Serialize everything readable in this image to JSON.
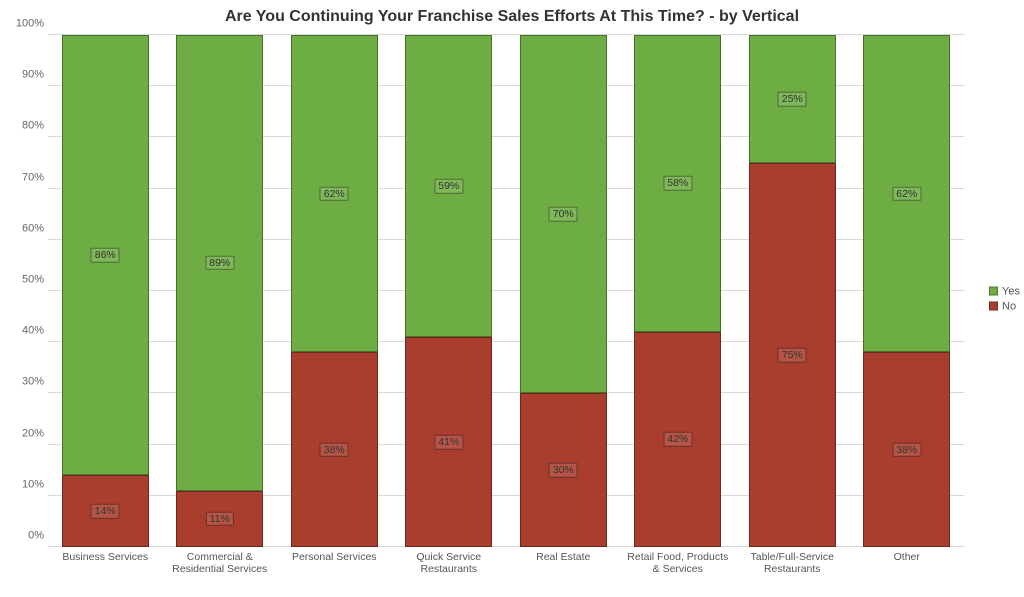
{
  "chart_data": {
    "type": "bar",
    "stacked": true,
    "title": "Are You Continuing Your Franchise Sales Efforts At This Time? - by Vertical",
    "ylabel": "",
    "xlabel": "",
    "ylim": [
      0,
      100
    ],
    "y_ticks": [
      0,
      10,
      20,
      30,
      40,
      50,
      60,
      70,
      80,
      90,
      100
    ],
    "y_tick_labels": [
      "0%",
      "10%",
      "20%",
      "30%",
      "40%",
      "50%",
      "60%",
      "70%",
      "80%",
      "90%",
      "100%"
    ],
    "categories": [
      "Business Services",
      "Commercial & Residential Services",
      "Personal Services",
      "Quick Service Restaurants",
      "Real Estate",
      "Retail Food, Products & Services",
      "Table/Full-Service Restaurants",
      "Other"
    ],
    "series": [
      {
        "name": "No",
        "color": "#aa3e2e",
        "values": [
          14,
          11,
          38,
          41,
          30,
          42,
          75,
          38
        ],
        "labels": [
          "14%",
          "11%",
          "38%",
          "41%",
          "30%",
          "42%",
          "75%",
          "38%"
        ]
      },
      {
        "name": "Yes",
        "color": "#6ead44",
        "values": [
          86,
          89,
          62,
          59,
          70,
          58,
          25,
          62
        ],
        "labels": [
          "86%",
          "89%",
          "62%",
          "59%",
          "70%",
          "58%",
          "25%",
          "62%"
        ]
      }
    ],
    "legend": {
      "entries": [
        "Yes",
        "No"
      ],
      "position": "right"
    }
  }
}
